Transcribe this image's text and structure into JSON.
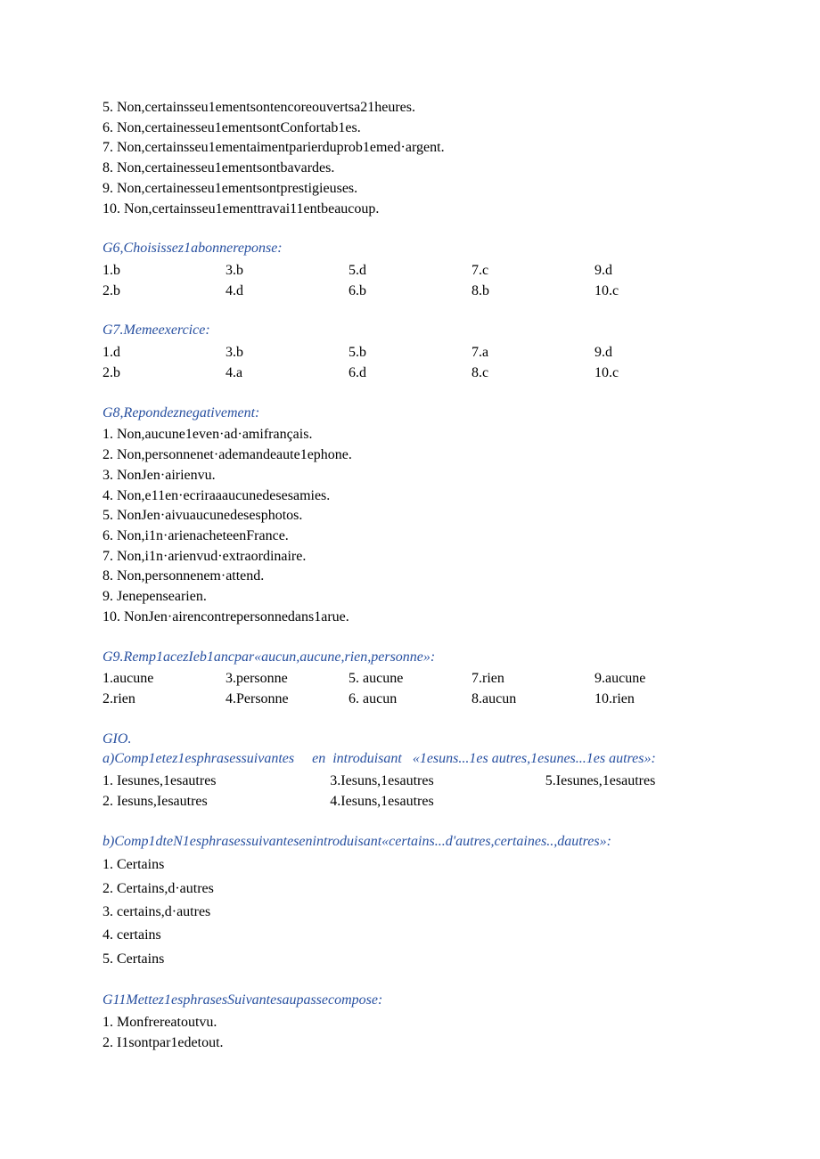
{
  "top_list": [
    "5.  Non,certainsseu1ementsontencoreouvertsa21heures.",
    "6.  Non,certainesseu1ementsontConfortab1es.",
    "7.  Non,certainsseu1ementaimentparierduprob1emed·argent.",
    "8.  Non,certainesseu1ementsontbavardes.",
    "9.  Non,certainesseu1ementsontprestigieuses.",
    "10.  Non,certainsseu1ementtravai11entbeaucoup."
  ],
  "g6": {
    "title": "G6,Choisissez1abonnereponse:",
    "cells": [
      "1.b",
      "3.b",
      "5.d",
      "7.c",
      "9.d",
      "2.b",
      "4.d",
      "6.b",
      "8.b",
      "10.c"
    ]
  },
  "g7": {
    "title": "G7.Memeexercice:",
    "cells": [
      "1.d",
      "3.b",
      "5.b",
      "7.a",
      "9.d",
      "2.b",
      "4.a",
      "6.d",
      "8.c",
      "10.c"
    ]
  },
  "g8": {
    "title": "G8,Repondeznegativement:",
    "items": [
      "1.  Non,aucune1even·ad·amifrançais.",
      "2.  Non,personnenet·ademandeaute1ephone.",
      "3.  NonJen·airienvu.",
      "4.  Non,e11en·ecriraaaucunedesesamies.",
      "5.  NonJen·aivuaucunedesesphotos.",
      "6.  Non,i1n·arienacheteenFrance.",
      "7.  Non,i1n·arienvud·extraordinaire.",
      "8.  Non,personnenem·attend.",
      "9.  Jenepensearien.",
      "10.  NonJen·airencontrepersonnedans1arue."
    ]
  },
  "g9": {
    "title": "G9.Remp1acezIeb1ancpar«aucun,aucune,rien,personne»:",
    "cells": [
      "1.aucune",
      "3.personne",
      "5.  aucune",
      "7.rien",
      "9.aucune",
      "2.rien",
      "4.Personne",
      "6.  aucun",
      "8.aucun",
      "10.rien"
    ]
  },
  "g10": {
    "title1": "GIO.",
    "title2a": "a)Comp1etez1esphrasessuivantes     en  introduisant   «1esuns...1es autres,1esunes...1es autres»:",
    "a_cells": [
      "1.  Iesunes,1esautres",
      "3.Iesuns,1esautres",
      "5.Iesunes,1esautres",
      "2.  Iesuns,Iesautres",
      "4.Iesuns,1esautres",
      ""
    ],
    "title2b": "b)Comp1dteN1esphrasessuivantesenintroduisant«certains...d'autres,certaines..,dautres»:",
    "b_items": [
      "1.   Certains",
      "2.   Certains,d·autres",
      "3.   certains,d·autres",
      "4.   certains",
      "5.   Certains"
    ]
  },
  "g11": {
    "title": "G11Mettez1esphrasesSuivantesaupassecompose:",
    "items": [
      "1.   Monfrereatoutvu.",
      "2.   I1sontpar1edetout."
    ]
  }
}
